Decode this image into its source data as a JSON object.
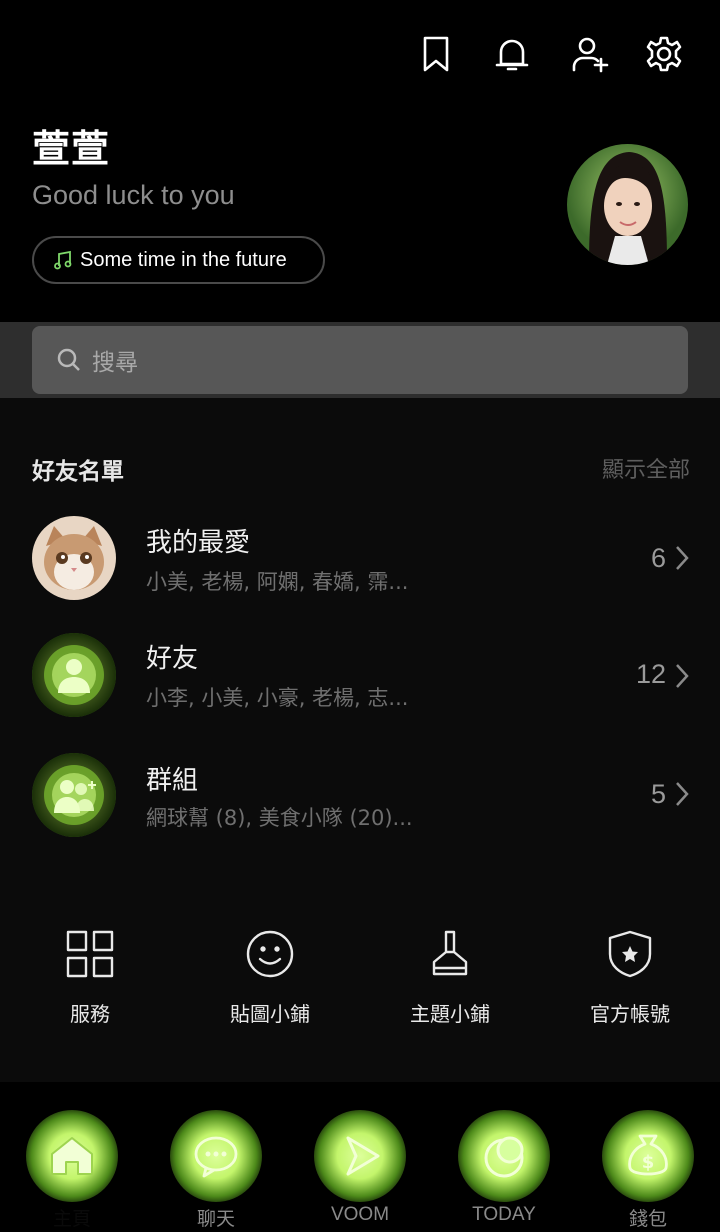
{
  "header": {
    "icons": [
      "bookmark-icon",
      "bell-icon",
      "add-friend-icon",
      "gear-icon"
    ]
  },
  "profile": {
    "name": "萱萱",
    "status": "Good luck to you",
    "music": "Some time in the future"
  },
  "search": {
    "placeholder": "搜尋"
  },
  "friends": {
    "title": "好友名單",
    "show_all": "顯示全部",
    "rows": [
      {
        "title": "我的最愛",
        "sub": "小美, 老楊, 阿嫻, 春嬌, 霈...",
        "count": "6"
      },
      {
        "title": "好友",
        "sub": "小李, 小美, 小豪, 老楊, 志...",
        "count": "12"
      },
      {
        "title": "群組",
        "sub": "網球幫 (8), 美食小隊 (20)...",
        "count": "5"
      }
    ]
  },
  "services": [
    {
      "label": "服務",
      "icon": "grid-icon"
    },
    {
      "label": "貼圖小鋪",
      "icon": "smiley-icon"
    },
    {
      "label": "主題小鋪",
      "icon": "brush-icon"
    },
    {
      "label": "官方帳號",
      "icon": "shield-star-icon"
    }
  ],
  "nav": [
    {
      "label": "主頁",
      "icon": "home-icon"
    },
    {
      "label": "聊天",
      "icon": "chat-icon"
    },
    {
      "label": "VOOM",
      "icon": "play-icon"
    },
    {
      "label": "TODAY",
      "icon": "moon-icon"
    },
    {
      "label": "錢包",
      "icon": "wallet-icon"
    }
  ],
  "colors": {
    "accent": "#b8ef5a",
    "music_note": "#7fd86a",
    "background": "#000000"
  }
}
